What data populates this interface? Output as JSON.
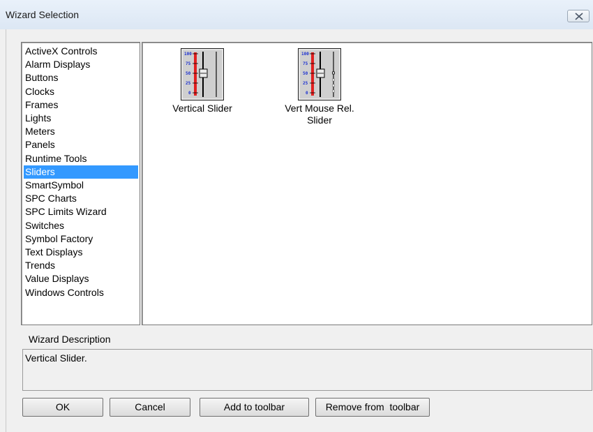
{
  "window": {
    "title": "Wizard Selection",
    "close_icon": "close-icon"
  },
  "categories": {
    "items": [
      "ActiveX Controls",
      "Alarm Displays",
      "Buttons",
      "Clocks",
      "Frames",
      "Lights",
      "Meters",
      "Panels",
      "Runtime Tools",
      "Sliders",
      "SmartSymbol",
      "SPC Charts",
      "SPC Limits Wizard",
      "Switches",
      "Symbol Factory",
      "Text Displays",
      "Trends",
      "Value Displays",
      "Windows Controls"
    ],
    "selected_index": 9
  },
  "wizards": [
    {
      "label": "Vertical Slider",
      "icon": "vertical-slider-icon",
      "scale": [
        "100",
        "75",
        "50",
        "25",
        "0"
      ]
    },
    {
      "label": "Vert Mouse Rel.\nSlider",
      "label_lines": [
        "Vert Mouse Rel.",
        "Slider"
      ],
      "icon": "vert-mouse-rel-slider-icon",
      "scale": [
        "100",
        "75",
        "50",
        "25",
        "0"
      ]
    }
  ],
  "description": {
    "label": "Wizard Description",
    "text": "Vertical Slider."
  },
  "buttons": {
    "ok": "OK",
    "cancel": "Cancel",
    "add": "Add to toolbar",
    "remove": "Remove from  toolbar"
  },
  "colors": {
    "selection": "#3399ff",
    "slider_red": "#e02020",
    "scale_blue": "#1a2fd0"
  }
}
